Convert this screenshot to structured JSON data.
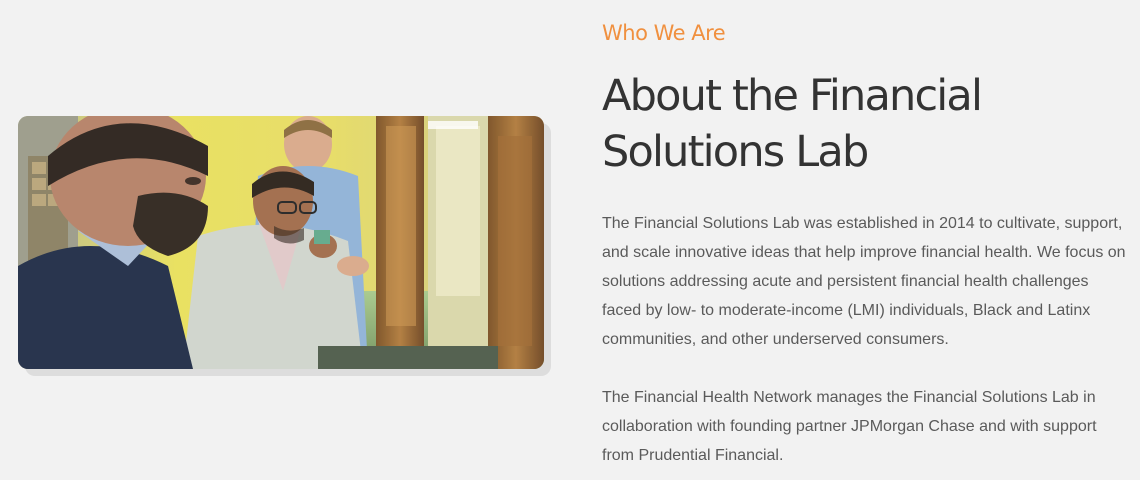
{
  "about": {
    "eyebrow": "Who We Are",
    "title_line1": "About the Financial",
    "title_line2": "Solutions Lab",
    "paragraph1": "The Financial Solutions Lab was established in 2014 to cultivate, support, and scale innovative ideas that help improve financial health. We focus on solutions addressing acute and persistent financial health challenges faced by low- to moderate-income (LMI) individuals, Black and Latinx communities, and other underserved consumers.",
    "paragraph2": "The Financial Health Network manages the Financial Solutions Lab in collaboration with founding partner JPMorgan Chase and with support from Prudential Financial."
  },
  "colors": {
    "accent": "#f0903f",
    "heading": "#333333",
    "body_text": "#5a5a5a",
    "background": "#f2f2f2"
  }
}
